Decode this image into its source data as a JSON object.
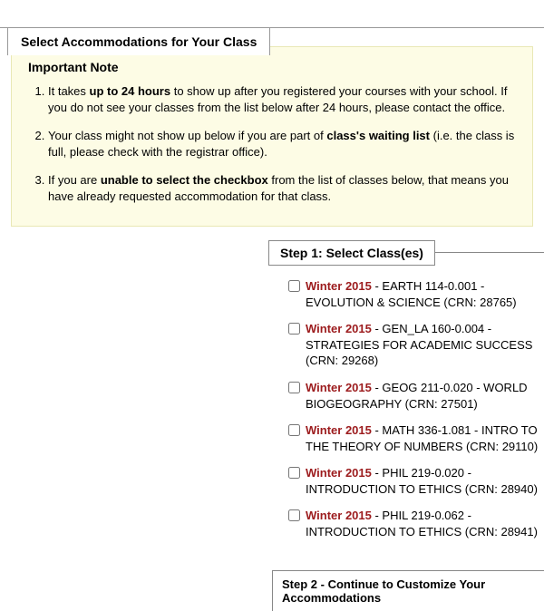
{
  "tab": {
    "title": "Select Accommodations for Your Class"
  },
  "note": {
    "title": "Important Note",
    "items": [
      {
        "pre": "It takes ",
        "strong": "up to 24 hours",
        "post": " to show up after you registered your courses with your school. If you do not see your classes from the list below after 24 hours, please contact the office."
      },
      {
        "pre": "Your class might not show up below if you are part of ",
        "strong": "class's waiting list",
        "post": " (i.e. the class is full, please check with the registrar office)."
      },
      {
        "pre": "If you are ",
        "strong": "unable to select the checkbox",
        "post": " from the list of classes below, that means you have already requested accommodation for that class."
      }
    ]
  },
  "step1": {
    "legend": "Step 1: Select Class(es)",
    "classes": [
      {
        "term": "Winter 2015",
        "course": " - EARTH 114-0.001 - EVOLUTION & SCIENCE (CRN: 28765)"
      },
      {
        "term": "Winter 2015",
        "course": " - GEN_LA 160-0.004 - STRATEGIES FOR ACADEMIC SUCCESS (CRN: 29268)"
      },
      {
        "term": "Winter 2015",
        "course": " - GEOG 211-0.020 - WORLD BIOGEOGRAPHY (CRN: 27501)"
      },
      {
        "term": "Winter 2015",
        "course": " - MATH 336-1.081 - INTRO TO THE THEORY OF NUMBERS (CRN: 29110)"
      },
      {
        "term": "Winter 2015",
        "course": " - PHIL 219-0.020 - INTRODUCTION TO ETHICS (CRN: 28940)"
      },
      {
        "term": "Winter 2015",
        "course": " - PHIL 219-0.062 - INTRODUCTION TO ETHICS (CRN: 28941)"
      }
    ]
  },
  "step2": {
    "label": "Step 2 - Continue to Customize Your Accommodations"
  }
}
